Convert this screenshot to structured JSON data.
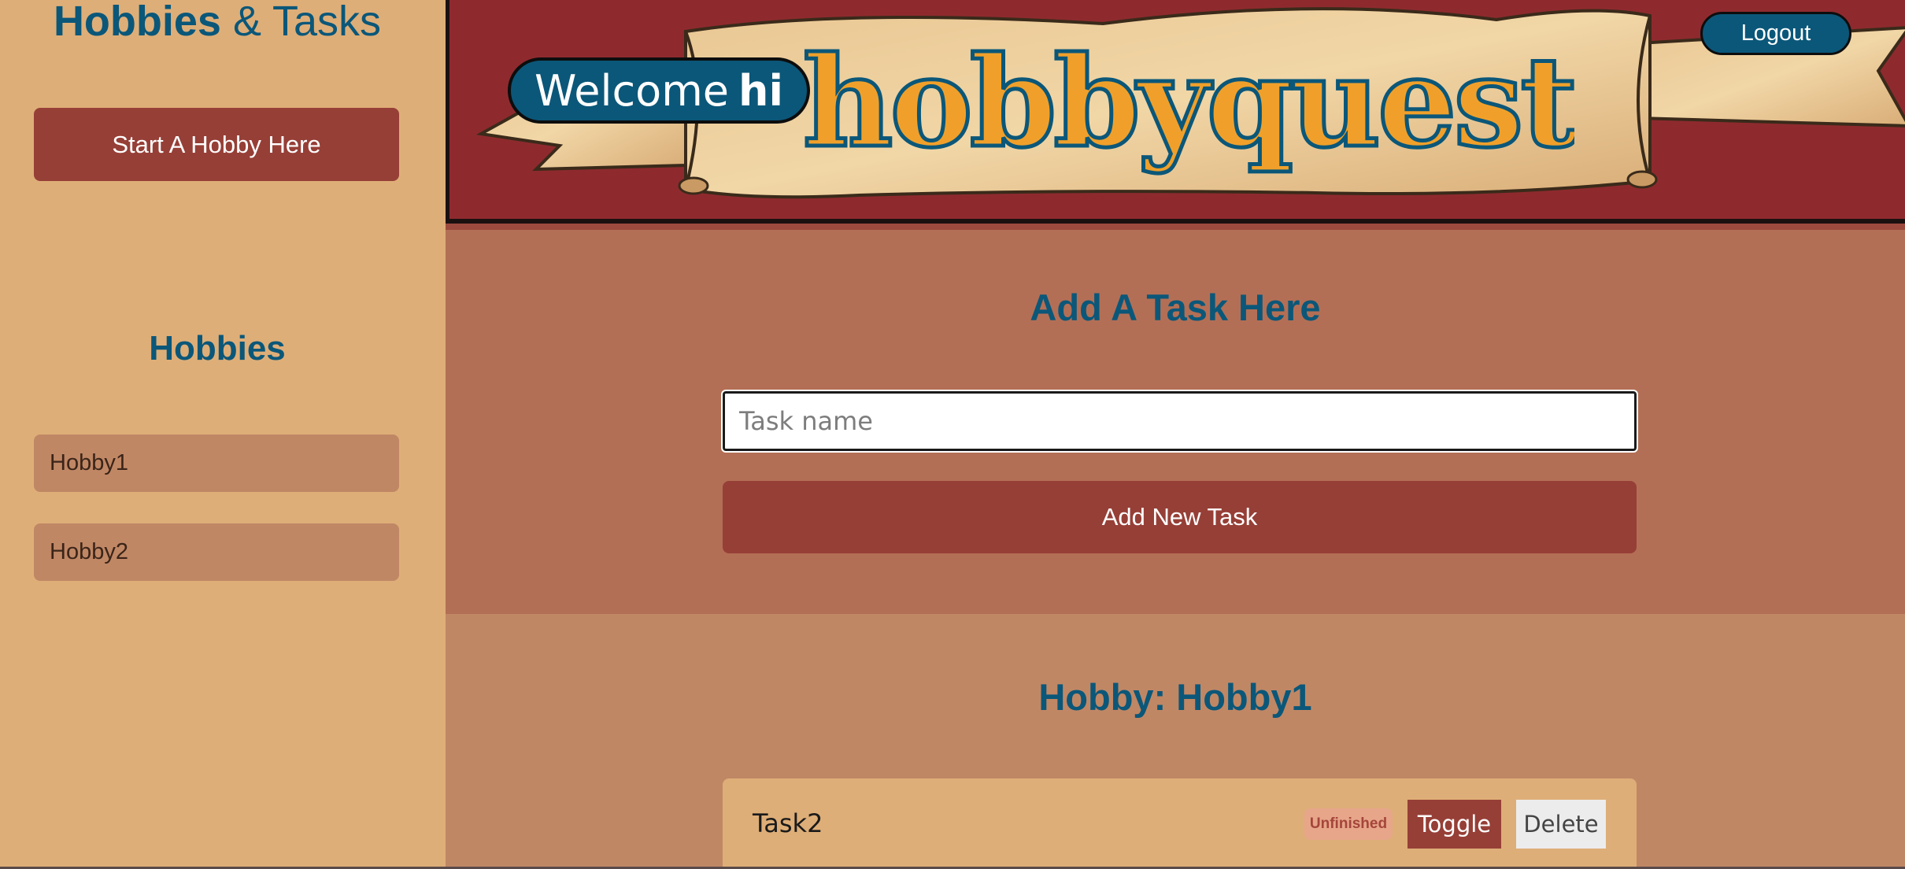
{
  "app_title": {
    "bold": "Hobbies",
    "rest": "& Tasks"
  },
  "sidebar": {
    "start_button": "Start A Hobby Here",
    "hobbies_heading": "Hobbies",
    "hobbies": [
      {
        "label": "Hobby1"
      },
      {
        "label": "Hobby2"
      }
    ]
  },
  "banner": {
    "welcome": "Welcome",
    "username": "hi",
    "logo_text": "hobbyquest",
    "logout_label": "Logout"
  },
  "add_task": {
    "heading": "Add A Task Here",
    "input_placeholder": "Task name",
    "input_value": "",
    "button_label": "Add New Task"
  },
  "hobby_detail": {
    "heading": "Hobby: Hobby1",
    "tasks": [
      {
        "name": "Task2",
        "status": "Unfinished",
        "toggle_label": "Toggle",
        "delete_label": "Delete"
      }
    ]
  },
  "colors": {
    "sidebar_bg": "#deae78",
    "accent_blue": "#0b5779",
    "button_red": "#963f37",
    "banner_red": "#8e2a2e",
    "section_bg": "#b36f55",
    "page_bg": "#c08765",
    "logo_gold": "#f0a02a"
  }
}
